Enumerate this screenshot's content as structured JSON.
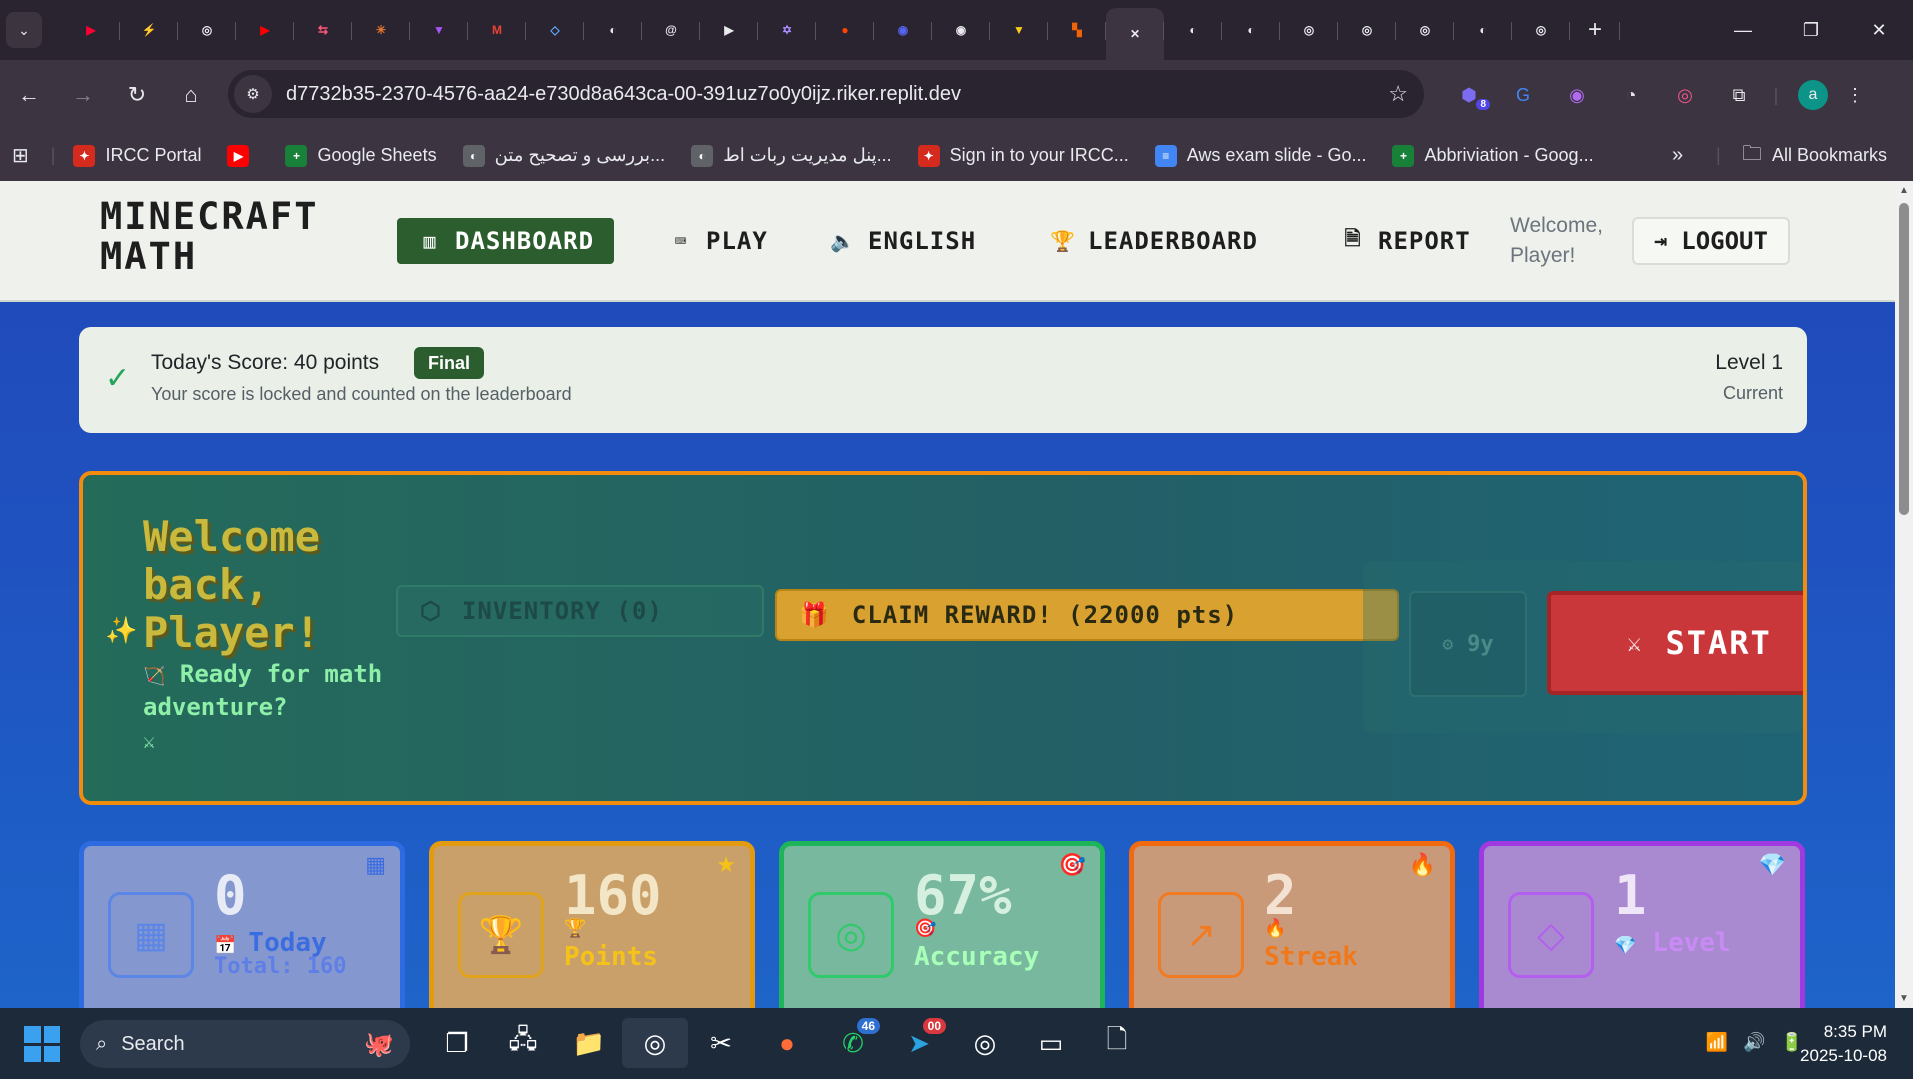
{
  "browser": {
    "tabs": [
      {
        "icon": "youtube-music-icon",
        "glyph": "▶",
        "color": "#ff0033"
      },
      {
        "icon": "bolt-icon",
        "glyph": "⚡",
        "color": "#22c55e"
      },
      {
        "icon": "chatgpt-icon",
        "glyph": "◎",
        "color": "#e8eaed"
      },
      {
        "icon": "youtube-icon",
        "glyph": "▶",
        "color": "#ff0000"
      },
      {
        "icon": "flow-icon",
        "glyph": "⇆",
        "color": "#ff5577"
      },
      {
        "icon": "claude-icon",
        "glyph": "✳",
        "color": "#e8772e"
      },
      {
        "icon": "vite-icon",
        "glyph": "▼",
        "color": "#a855f7"
      },
      {
        "icon": "gmail-icon",
        "glyph": "M",
        "color": "#ea4335"
      },
      {
        "icon": "cube-icon",
        "glyph": "◇",
        "color": "#60a5fa"
      },
      {
        "icon": "globe-icon",
        "glyph": "◐",
        "color": "#e8eaed"
      },
      {
        "icon": "threads-icon",
        "glyph": "@",
        "color": "#e8eaed"
      },
      {
        "icon": "play-circle-icon",
        "glyph": "▶",
        "color": "#e8eaed"
      },
      {
        "icon": "star-of-david-icon",
        "glyph": "✡",
        "color": "#a78bfa"
      },
      {
        "icon": "reddit-icon",
        "glyph": "●",
        "color": "#ff4500"
      },
      {
        "icon": "discord-icon",
        "glyph": "◉",
        "color": "#5865f2"
      },
      {
        "icon": "github-icon",
        "glyph": "◉",
        "color": "#e8eaed"
      },
      {
        "icon": "vite-icon",
        "glyph": "▼",
        "color": "#facc15"
      },
      {
        "icon": "replit-icon",
        "glyph": "▚",
        "color": "#f26207"
      },
      {
        "icon": "close-icon",
        "glyph": "✕",
        "color": "#e8eaed",
        "active": true
      },
      {
        "icon": "globe-icon",
        "glyph": "◐",
        "color": "#e8eaed"
      },
      {
        "icon": "globe-icon",
        "glyph": "◐",
        "color": "#e8eaed"
      },
      {
        "icon": "chrome-icon",
        "glyph": "◎",
        "color": "#e8eaed"
      },
      {
        "icon": "chrome-icon",
        "glyph": "◎",
        "color": "#e8eaed"
      },
      {
        "icon": "chrome-icon",
        "glyph": "◎",
        "color": "#e8eaed"
      },
      {
        "icon": "globe-icon",
        "glyph": "◐",
        "color": "#e8eaed"
      },
      {
        "icon": "chatgpt-icon",
        "glyph": "◎",
        "color": "#e8eaed"
      }
    ],
    "url": "d7732b35-2370-4576-aa24-e730d8a643ca-00-391uz7o0y0ijz.riker.replit.dev",
    "extension_badge": "8",
    "profile_initial": "a",
    "bookmarks": [
      {
        "label": "IRCC Portal",
        "icon": "maple-leaf-icon",
        "color": "#d52b1e",
        "glyph": "✦"
      },
      {
        "label": "",
        "icon": "youtube-icon",
        "color": "#ff0000",
        "glyph": "▶"
      },
      {
        "label": "Google Sheets",
        "icon": "sheets-icon",
        "color": "#188038",
        "glyph": "+"
      },
      {
        "label": "بررسی و تصحیح متن...",
        "icon": "globe-icon",
        "color": "#5f6368",
        "glyph": "◐"
      },
      {
        "label": "پنل مدیریت ربات اط...",
        "icon": "globe-icon",
        "color": "#5f6368",
        "glyph": "◐"
      },
      {
        "label": "Sign in to your IRCC...",
        "icon": "maple-leaf-icon",
        "color": "#d52b1e",
        "glyph": "✦"
      },
      {
        "label": "Aws exam slide - Go...",
        "icon": "docs-icon",
        "color": "#4285f4",
        "glyph": "≡"
      },
      {
        "label": "Abbriviation - Goog...",
        "icon": "sheets-icon",
        "color": "#188038",
        "glyph": "+"
      }
    ],
    "all_bookmarks": "All Bookmarks"
  },
  "nav": {
    "brand_line1": "MINECRAFT",
    "brand_line2": "MATH",
    "dashboard": "DASHBOARD",
    "play": "PLAY",
    "english": "ENGLISH",
    "leaderboard": "LEADERBOARD",
    "report": "REPORT",
    "welcome_line1": "Welcome,",
    "welcome_line2": "Player!",
    "logout": "LOGOUT"
  },
  "score": {
    "title": "Today's Score: 40 points",
    "badge": "Final",
    "subtitle": "Your score is locked and counted on the leaderboard",
    "level": "Level 1",
    "level_status": "Current"
  },
  "hero": {
    "title": "Welcome back, Player!",
    "subtitle": "Ready for math adventure?",
    "inventory": "INVENTORY (0)",
    "claim": "CLAIM REWARD! (22000 pts)",
    "time": "9y",
    "start": "START"
  },
  "stats": [
    {
      "value": "0",
      "label": "Today",
      "extra": "Total: 160",
      "icon": "calendar-icon",
      "corner": "calendar-icon"
    },
    {
      "value": "160",
      "label": "Points",
      "icon": "trophy-icon",
      "corner": "star-icon"
    },
    {
      "value": "67%",
      "label": "Accuracy",
      "icon": "target-icon",
      "corner": "dart-icon"
    },
    {
      "value": "2",
      "label": "Streak",
      "icon": "trending-up-icon",
      "corner": "fire-icon"
    },
    {
      "value": "1",
      "label": "Level",
      "icon": "diamond-icon",
      "corner": "gem-icon"
    }
  ],
  "taskbar": {
    "search": "Search",
    "whatsapp_count": "46",
    "telegram_count": "00",
    "time": "8:35 PM",
    "date": "2025-10-08"
  }
}
